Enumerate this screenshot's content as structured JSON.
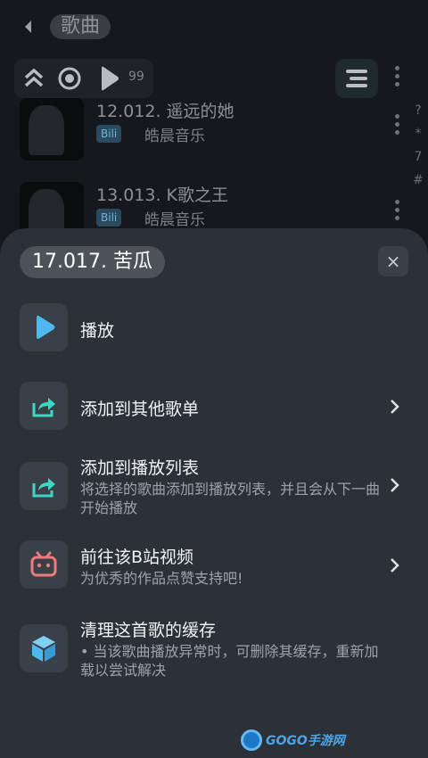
{
  "header": {
    "title": "歌曲"
  },
  "toolbar": {
    "count": "99"
  },
  "songs": [
    {
      "title": "12.012. 遥远的她",
      "tag": "Bili",
      "artist": "皓晨音乐"
    },
    {
      "title": "13.013. K歌之王",
      "tag": "Bili",
      "artist": "皓晨音乐"
    }
  ],
  "index_bar": [
    "?",
    "*",
    "7",
    "#"
  ],
  "sheet": {
    "title": "17.017. 苦瓜",
    "close": "×",
    "items": [
      {
        "label": "播放",
        "icon": "play-icon"
      },
      {
        "label": "添加到其他歌单",
        "icon": "share-icon"
      },
      {
        "label": "添加到播放列表",
        "desc": "将选择的歌曲添加到播放列表，并且会从下一曲开始播放",
        "icon": "share-icon"
      },
      {
        "label": "前往该B站视频",
        "desc": "为优秀的作品点赞支持吧!",
        "icon": "bilibili-icon"
      },
      {
        "label": "清理这首歌的缓存",
        "desc": "• 当该歌曲播放异常时，可删除其缓存，重新加载以尝试解决",
        "icon": "cube-icon"
      }
    ]
  },
  "watermark": {
    "text": "GOGO手游网"
  },
  "colors": {
    "accent_blue": "#4fb8f0",
    "accent_teal": "#3fd6c4",
    "accent_red": "#f07b7b"
  }
}
